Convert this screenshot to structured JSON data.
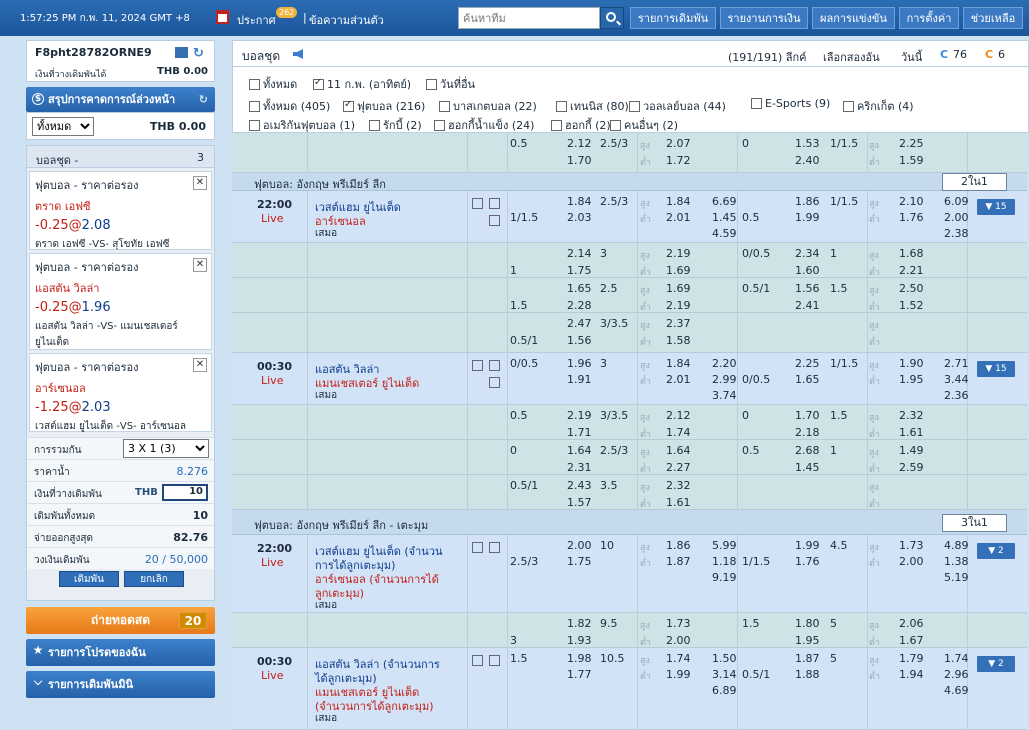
{
  "topbar": {
    "clock": "1:57:25 PM ก.พ. 11, 2024 GMT +8",
    "announce_label": "ประกาศ",
    "announce_count": "262",
    "separator": "|",
    "messages_label": "ข้อความส่วนตัว",
    "search_placeholder": "ค้นหาทีม",
    "nav": [
      "รายการเดิมพัน",
      "รายงานการเงิน",
      "ผลการแข่งขัน",
      "การตั้งค่า",
      "ช่วยเหลือ"
    ]
  },
  "account": {
    "id": "F8pht28782ORNE9",
    "balance_label": "เงินที่วางเดิมพันได้",
    "balance_value": "THB 0.00"
  },
  "summary": {
    "title": "สรุปการคาดการณ์ล่วงหน้า",
    "select_value": "ทั้งหมด",
    "value": "THB 0.00"
  },
  "betslip": {
    "title": "บอลชุด -",
    "count": "3",
    "items": [
      {
        "type": "ฟุตบอล - ราคาต่อรอง",
        "team": "ตราด เอฟซี",
        "hdp": "-0.25",
        "at": "@",
        "odds": "2.08",
        "match": "ตราด เอฟซี -VS- สุโขทัย เอฟซี"
      },
      {
        "type": "ฟุตบอล - ราคาต่อรอง",
        "team": "แอสตัน วิลล่า",
        "hdp": "-0.25",
        "at": "@",
        "odds": "1.96",
        "match": "แอสตัน วิลล่า -VS- แมนเชสเตอร์ ยูไนเต็ด"
      },
      {
        "type": "ฟุตบอล - ราคาต่อรอง",
        "team": "อาร์เซนอล",
        "hdp": "-1.25",
        "at": "@",
        "odds": "2.03",
        "match": "เวสต์แฮม ยูไนเต็ด -VS- อาร์เซนอล"
      }
    ],
    "combo_label": "การรวมกัน",
    "combo_value": "3 X 1 (3)",
    "price_label": "ราคาน้ำ",
    "price_value": "8.276",
    "stake_label": "เงินที่วางเดิมพัน",
    "stake_currency": "THB",
    "stake_value": "10",
    "total_label": "เดิมพันทั้งหมด",
    "total_value": "10",
    "maxpay_label": "จ่ายออกสูงสุด",
    "maxpay_value": "82.76",
    "limit_label": "วงเงินเดิมพัน",
    "limit_value": "20 / 50,000",
    "bet_btn": "เดิมพัน",
    "cancel_btn": "ยกเลิก"
  },
  "live_stream": {
    "label": "ถ่ายทอดสด",
    "count": "20"
  },
  "favorites": {
    "label": "รายการโปรดของฉัน"
  },
  "mini_bets": {
    "label": "รายการเดิมพันมินิ"
  },
  "header": {
    "title": "บอลชุด",
    "league_count": "(191/191) ลีกค์",
    "select_two": "เลือกสองอัน",
    "date": "วันนี้",
    "live_count": "76",
    "other_count": "6"
  },
  "filters": {
    "days": [
      {
        "label": "ทั้งหมด",
        "checked": false
      },
      {
        "label": "11 ก.พ. (อาทิตย์)",
        "checked": true
      },
      {
        "label": "วันที่อื่น",
        "checked": false
      }
    ],
    "sports": [
      {
        "label": "ทั้งหมด (405)",
        "checked": false
      },
      {
        "label": "ฟุตบอล (216)",
        "checked": true
      },
      {
        "label": "บาสเกตบอล (22)",
        "checked": false
      },
      {
        "label": "เทนนิส (80)",
        "checked": false
      },
      {
        "label": "วอลเลย์บอล (44)",
        "checked": false
      },
      {
        "label": "E-Sports (9)",
        "checked": false
      },
      {
        "label": "คริกเก็ต (4)",
        "checked": false
      },
      {
        "label": "อเมริกันฟุตบอล (1)",
        "checked": false
      },
      {
        "label": "รักบี้ (2)",
        "checked": false
      },
      {
        "label": "ฮอกกี้น้ำแข็ง (24)",
        "checked": false
      },
      {
        "label": "ฮอกกี้ (2)",
        "checked": false
      },
      {
        "label": "คนอื่นๆ (2)",
        "checked": false
      }
    ]
  },
  "grid": {
    "hi": "สูง",
    "lo": "ต่ำ",
    "sections": [
      {
        "name": "ฟุตบอล: อังกฤษ พรีเมียร์ ลีก",
        "page": "2ใน1"
      },
      {
        "name": "ฟุตบอล: อังกฤษ พรีเมียร์ ลีก - เตะมุม",
        "page": "3ใน1"
      }
    ],
    "matches": [
      {
        "time": "22:00",
        "live": "Live",
        "home": "เวสต์แฮม ยูไนเต็ด",
        "away": "อาร์เซนอล",
        "draw": "เสมอ",
        "more": "▼ 15"
      },
      {
        "time": "00:30",
        "live": "Live",
        "home": "แอสตัน วิลล่า",
        "away": "แมนเชสเตอร์ ยูไนเต็ด",
        "draw": "เสมอ",
        "more": "▼ 15"
      },
      {
        "time": "22:00",
        "live": "Live",
        "home": "เวสต์แฮม ยูไนเต็ด (จำนวน",
        "home2": "การได้ลูกเตะมุม)",
        "away": "อาร์เซนอล (จำนวนการได้",
        "away2": "ลูกเตะมุม)",
        "draw": "เสมอ",
        "more": "▼ 2"
      },
      {
        "time": "00:30",
        "live": "Live",
        "home": "แอสตัน วิลล่า (จำนวนการ",
        "home2": "ได้ลูกเตะมุม)",
        "away": "แมนเชสเตอร์ ยูไนเต็ด",
        "away2": "(จำนวนการได้ลูกเตะมุม)",
        "draw": "เสมอ",
        "more": "▼ 2"
      }
    ],
    "odds_rows": [
      {
        "hdp": "",
        "h1": "0.5",
        "o1": "2.12",
        "o2": "1.70",
        "ou": "2.5/3",
        "u1": "2.07",
        "u2": "1.72",
        "x": [
          "",
          "",
          ""
        ],
        "fh": "0",
        "f1": "1.53",
        "f2": "2.40",
        "fou": "1/1.5",
        "fu1": "2.25",
        "fu2": "1.59",
        "fx": [
          "",
          "",
          ""
        ]
      },
      {
        "hdp": "1/1.5",
        "h1": "",
        "o1": "1.84",
        "o2": "2.03",
        "ou": "2.5/3",
        "u1": "1.84",
        "u2": "2.01",
        "x": [
          "6.69",
          "1.45",
          "4.59"
        ],
        "fh": "0.5",
        "f1": "1.86",
        "f2": "1.99",
        "fou": "1/1.5",
        "fu1": "2.10",
        "fu2": "1.76",
        "fx": [
          "6.09",
          "2.00",
          "2.38"
        ]
      },
      {
        "hdp": "1",
        "h1": "",
        "o1": "2.14",
        "o2": "1.75",
        "ou": "3",
        "u1": "2.19",
        "u2": "1.69",
        "x": [
          "",
          "",
          ""
        ],
        "fh": "0/0.5",
        "f1": "2.34",
        "f2": "1.60",
        "fou": "1",
        "fu1": "1.68",
        "fu2": "2.21",
        "fx": [
          "",
          "",
          ""
        ]
      },
      {
        "hdp": "1.5",
        "h1": "",
        "o1": "1.65",
        "o2": "2.28",
        "ou": "2.5",
        "u1": "1.69",
        "u2": "2.19",
        "x": [
          "",
          "",
          ""
        ],
        "fh": "0.5/1",
        "f1": "1.56",
        "f2": "2.41",
        "fou": "1.5",
        "fu1": "2.50",
        "fu2": "1.52",
        "fx": [
          "",
          "",
          ""
        ]
      },
      {
        "hdp": "0.5/1",
        "h1": "",
        "o1": "2.47",
        "o2": "1.56",
        "ou": "3/3.5",
        "u1": "2.37",
        "u2": "1.58",
        "x": [
          "",
          "",
          ""
        ],
        "fh": "",
        "f1": "",
        "f2": "",
        "fou": "",
        "fu1": "",
        "fu2": "",
        "fx": [
          "",
          "",
          ""
        ]
      },
      {
        "hdp": "",
        "h1": "0/0.5",
        "o1": "1.96",
        "o2": "1.91",
        "ou": "3",
        "u1": "1.84",
        "u2": "2.01",
        "x": [
          "2.20",
          "2.99",
          "3.74"
        ],
        "fh": "0/0.5",
        "f1": "2.25",
        "f2": "1.65",
        "fou": "1/1.5",
        "fu1": "1.90",
        "fu2": "1.95",
        "fx": [
          "2.71",
          "3.44",
          "2.36"
        ]
      },
      {
        "hdp": "",
        "h1": "0.5",
        "o1": "2.19",
        "o2": "1.71",
        "ou": "3/3.5",
        "u1": "2.12",
        "u2": "1.74",
        "x": [
          "",
          "",
          ""
        ],
        "fh": "0",
        "f1": "1.70",
        "f2": "2.18",
        "fou": "1.5",
        "fu1": "2.32",
        "fu2": "1.61",
        "fx": [
          "",
          "",
          ""
        ]
      },
      {
        "hdp": "",
        "h1": "0",
        "o1": "1.64",
        "o2": "2.31",
        "ou": "2.5/3",
        "u1": "1.64",
        "u2": "2.27",
        "x": [
          "",
          "",
          ""
        ],
        "fh": "0.5",
        "f1": "2.68",
        "f2": "1.45",
        "fou": "1",
        "fu1": "1.49",
        "fu2": "2.59",
        "fx": [
          "",
          "",
          ""
        ]
      },
      {
        "hdp": "",
        "h1": "0.5/1",
        "o1": "2.43",
        "o2": "1.57",
        "ou": "3.5",
        "u1": "2.32",
        "u2": "1.61",
        "x": [
          "",
          "",
          ""
        ],
        "fh": "",
        "f1": "",
        "f2": "",
        "fou": "",
        "fu1": "",
        "fu2": "",
        "fx": [
          "",
          "",
          ""
        ]
      },
      {
        "hdp": "2.5/3",
        "h1": "",
        "o1": "2.00",
        "o2": "1.75",
        "ou": "10",
        "u1": "1.86",
        "u2": "1.87",
        "x": [
          "5.99",
          "1.18",
          "9.19"
        ],
        "fh": "1/1.5",
        "f1": "1.99",
        "f2": "1.76",
        "fou": "4.5",
        "fu1": "1.73",
        "fu2": "2.00",
        "fx": [
          "4.89",
          "1.38",
          "5.19"
        ]
      },
      {
        "hdp": "3",
        "h1": "",
        "o1": "1.82",
        "o2": "1.93",
        "ou": "9.5",
        "u1": "1.73",
        "u2": "2.00",
        "x": [
          "",
          "",
          ""
        ],
        "fh": "1.5",
        "f1": "1.80",
        "f2": "1.95",
        "fou": "5",
        "fu1": "2.06",
        "fu2": "1.67",
        "fx": [
          "",
          "",
          ""
        ]
      },
      {
        "hdp": "",
        "h1": "1.5",
        "o1": "1.98",
        "o2": "1.77",
        "ou": "10.5",
        "u1": "1.74",
        "u2": "1.99",
        "x": [
          "1.50",
          "3.14",
          "6.89"
        ],
        "fh": "0.5/1",
        "f1": "1.87",
        "f2": "1.88",
        "fou": "5",
        "fu1": "1.79",
        "fu2": "1.94",
        "fx": [
          "1.74",
          "2.96",
          "4.69"
        ]
      }
    ]
  }
}
